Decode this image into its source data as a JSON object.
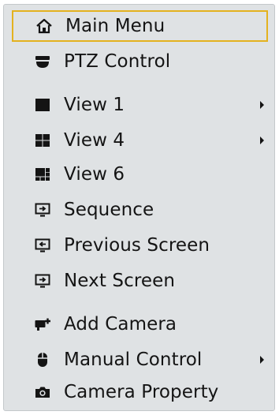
{
  "menu": {
    "items": [
      {
        "label": "Main Menu",
        "icon": "home-icon",
        "selected": true,
        "submenu": false
      },
      {
        "label": "PTZ Control",
        "icon": "ptz-camera-icon",
        "selected": false,
        "submenu": false
      },
      {
        "label": "View 1",
        "icon": "view-1-icon",
        "selected": false,
        "submenu": true
      },
      {
        "label": "View 4",
        "icon": "view-4-icon",
        "selected": false,
        "submenu": true
      },
      {
        "label": "View 6",
        "icon": "view-6-icon",
        "selected": false,
        "submenu": false
      },
      {
        "label": "Sequence",
        "icon": "sequence-icon",
        "selected": false,
        "submenu": false
      },
      {
        "label": "Previous Screen",
        "icon": "previous-screen-icon",
        "selected": false,
        "submenu": false
      },
      {
        "label": "Next Screen",
        "icon": "next-screen-icon",
        "selected": false,
        "submenu": false
      },
      {
        "label": "Add Camera",
        "icon": "add-camera-icon",
        "selected": false,
        "submenu": false
      },
      {
        "label": "Manual Control",
        "icon": "mouse-icon",
        "selected": false,
        "submenu": true
      },
      {
        "label": "Camera Property",
        "icon": "camera-icon",
        "selected": false,
        "submenu": false
      }
    ]
  },
  "colors": {
    "background": "#dfe2e4",
    "text": "#141414",
    "selection_border": "#e4b21f"
  }
}
